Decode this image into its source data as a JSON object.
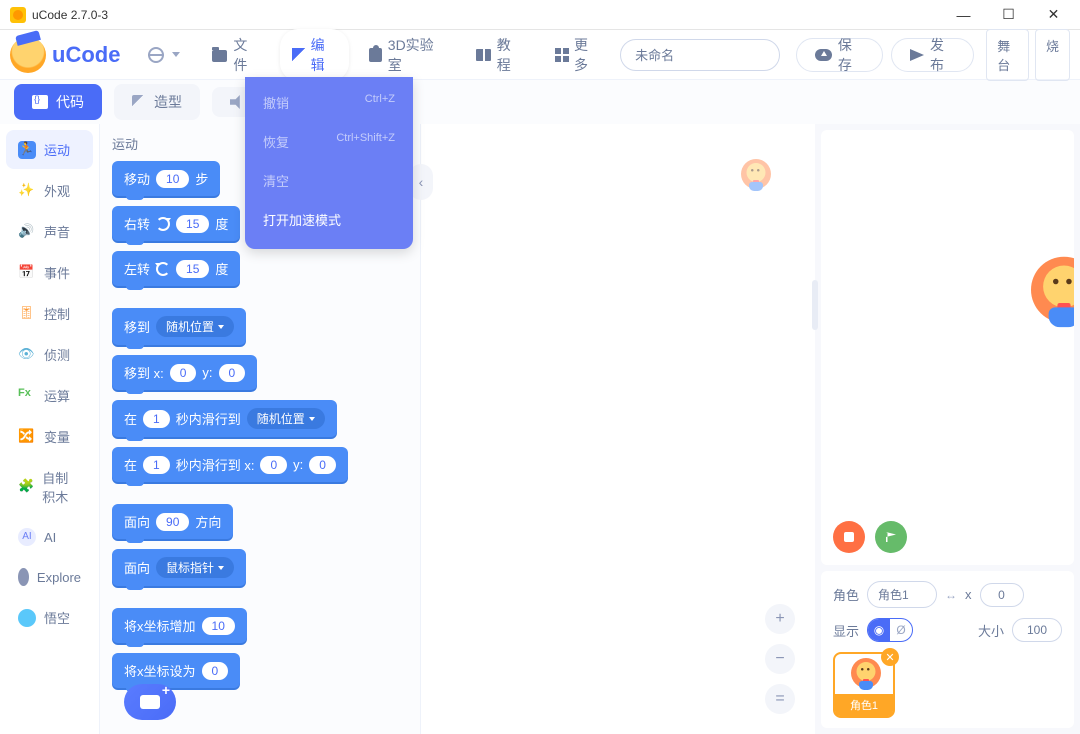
{
  "window": {
    "title": "uCode 2.7.0-3"
  },
  "brand": "uCode",
  "toolbar": {
    "file": "文件",
    "edit": "编辑",
    "lab3d": "3D实验室",
    "tutorial": "教程",
    "more": "更多",
    "project_name": "未命名",
    "save": "保存",
    "publish": "发布",
    "stage": "舞台",
    "burn": "烧"
  },
  "edit_menu": {
    "undo": {
      "label": "撤销",
      "shortcut": "Ctrl+Z"
    },
    "redo": {
      "label": "恢复",
      "shortcut": "Ctrl+Shift+Z"
    },
    "clear": {
      "label": "清空",
      "shortcut": ""
    },
    "turbo": {
      "label": "打开加速模式",
      "shortcut": ""
    }
  },
  "tabs": {
    "code": "代码",
    "costume": "造型",
    "sound": ""
  },
  "categories": [
    {
      "name": "运动",
      "color": "#4a8cf7"
    },
    {
      "name": "外观",
      "color": "#9c6cf7"
    },
    {
      "name": "声音",
      "color": "#cf63cf"
    },
    {
      "name": "事件",
      "color": "#ffab19"
    },
    {
      "name": "控制",
      "color": "#ff8c1a"
    },
    {
      "name": "侦测",
      "color": "#5cb1d6"
    },
    {
      "name": "运算",
      "color": "#59c059"
    },
    {
      "name": "变量",
      "color": "#ff8c1a"
    },
    {
      "name": "自制积木",
      "color": "#ff6680"
    },
    {
      "name": "AI",
      "color": "#6b7ff5"
    },
    {
      "name": "Explore",
      "color": "#8a95b5"
    },
    {
      "name": "悟空",
      "color": "#5ac8fa"
    }
  ],
  "palette": {
    "heading": "运动",
    "blocks": {
      "move": {
        "pre": "移动",
        "val": "10",
        "post": "步"
      },
      "turn_cw": {
        "pre": "右转",
        "val": "15",
        "post": "度"
      },
      "turn_ccw": {
        "pre": "左转",
        "val": "15",
        "post": "度"
      },
      "goto": {
        "pre": "移到",
        "opt": "随机位置"
      },
      "goto_xy": {
        "pre": "移到 x:",
        "x": "0",
        "mid": "y:",
        "y": "0"
      },
      "glide": {
        "pre": "在",
        "sec": "1",
        "mid": "秒内滑行到",
        "opt": "随机位置"
      },
      "glide_xy": {
        "pre": "在",
        "sec": "1",
        "mid": "秒内滑行到 x:",
        "x": "0",
        "mid2": "y:",
        "y": "0"
      },
      "point_dir": {
        "pre": "面向",
        "val": "90",
        "post": "方向"
      },
      "point_to": {
        "pre": "面向",
        "opt": "鼠标指针"
      },
      "change_x": {
        "pre": "将x坐标增加",
        "val": "10"
      },
      "set_x": {
        "pre": "将x坐标设为",
        "val": "0"
      }
    }
  },
  "sprite_info": {
    "role_label": "角色",
    "role_name": "角色1",
    "x_label": "x",
    "x_val": "0",
    "show_label": "显示",
    "size_label": "大小",
    "size_val": "100"
  },
  "sprites": [
    {
      "name": "角色1"
    }
  ]
}
